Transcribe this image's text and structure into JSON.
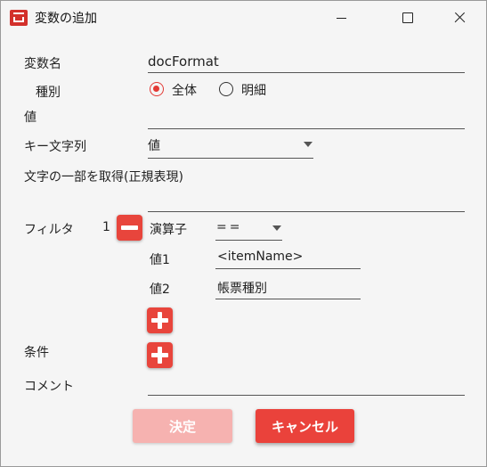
{
  "window": {
    "title": "変数の追加"
  },
  "form": {
    "var_name": {
      "label": "変数名",
      "value": "docFormat"
    },
    "type": {
      "label": "種別",
      "options": [
        "全体",
        "明細"
      ],
      "selected": "全体"
    },
    "value": {
      "label": "値",
      "value": ""
    },
    "key_string": {
      "label": "キー文字列",
      "value": "値"
    },
    "regex": {
      "label": "文字の一部を取得(正規表現)",
      "value": ""
    },
    "filter": {
      "label": "フィルタ",
      "index": "1",
      "operator_label": "演算子",
      "operator_value": "==",
      "value1_label": "値1",
      "value1": "<itemName>",
      "value2_label": "値2",
      "value2": "帳票種別"
    },
    "condition": {
      "label": "条件"
    },
    "comment": {
      "label": "コメント",
      "value": ""
    }
  },
  "buttons": {
    "ok": "決定",
    "cancel": "キャンセル"
  },
  "colors": {
    "accent": "#e8453c",
    "accent_disabled": "#f6b2b0"
  }
}
